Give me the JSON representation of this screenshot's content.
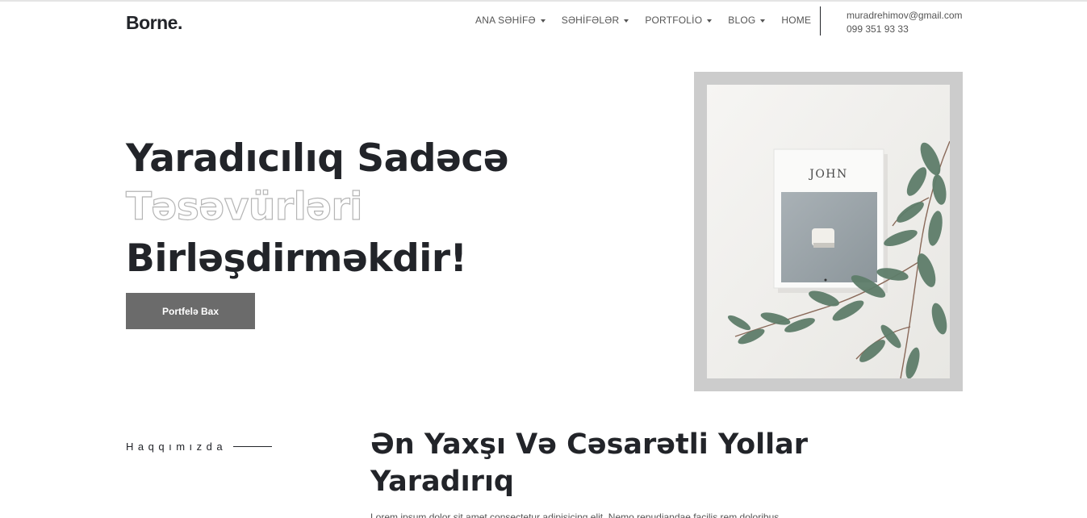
{
  "header": {
    "logo": "Borne.",
    "nav": [
      {
        "label": "ANA SƏHİFƏ",
        "dropdown": true
      },
      {
        "label": "SƏHİFƏLƏR",
        "dropdown": true
      },
      {
        "label": "PORTFOLİO",
        "dropdown": true
      },
      {
        "label": "BLOG",
        "dropdown": true
      },
      {
        "label": "HOME",
        "dropdown": false
      }
    ],
    "contact": {
      "email": "muradrehimov@gmail.com",
      "phone": "099 351 93 33"
    }
  },
  "hero": {
    "line1": "Yaradıcılıq Sadəcə",
    "line2": "Təsəvürləri",
    "line3": "Birləşdirməkdir!",
    "button_label": "Portfelə Bax",
    "image": {
      "book_title": "JOHN"
    }
  },
  "about": {
    "label": "Haqqımızda",
    "heading_line1": "Ən Yaxşı Və Cəsarətli Yollar",
    "heading_line2": "Yaradırıq",
    "text": "Lorem ipsum dolor sit amet consectetur adipisicing elit. Nemo repudiandae facilis rem doloribus"
  },
  "colors": {
    "text": "#222429",
    "muted": "#555555",
    "button": "#6b6b6b",
    "frame": "#cccccc",
    "outline": "#b5b5b5"
  }
}
